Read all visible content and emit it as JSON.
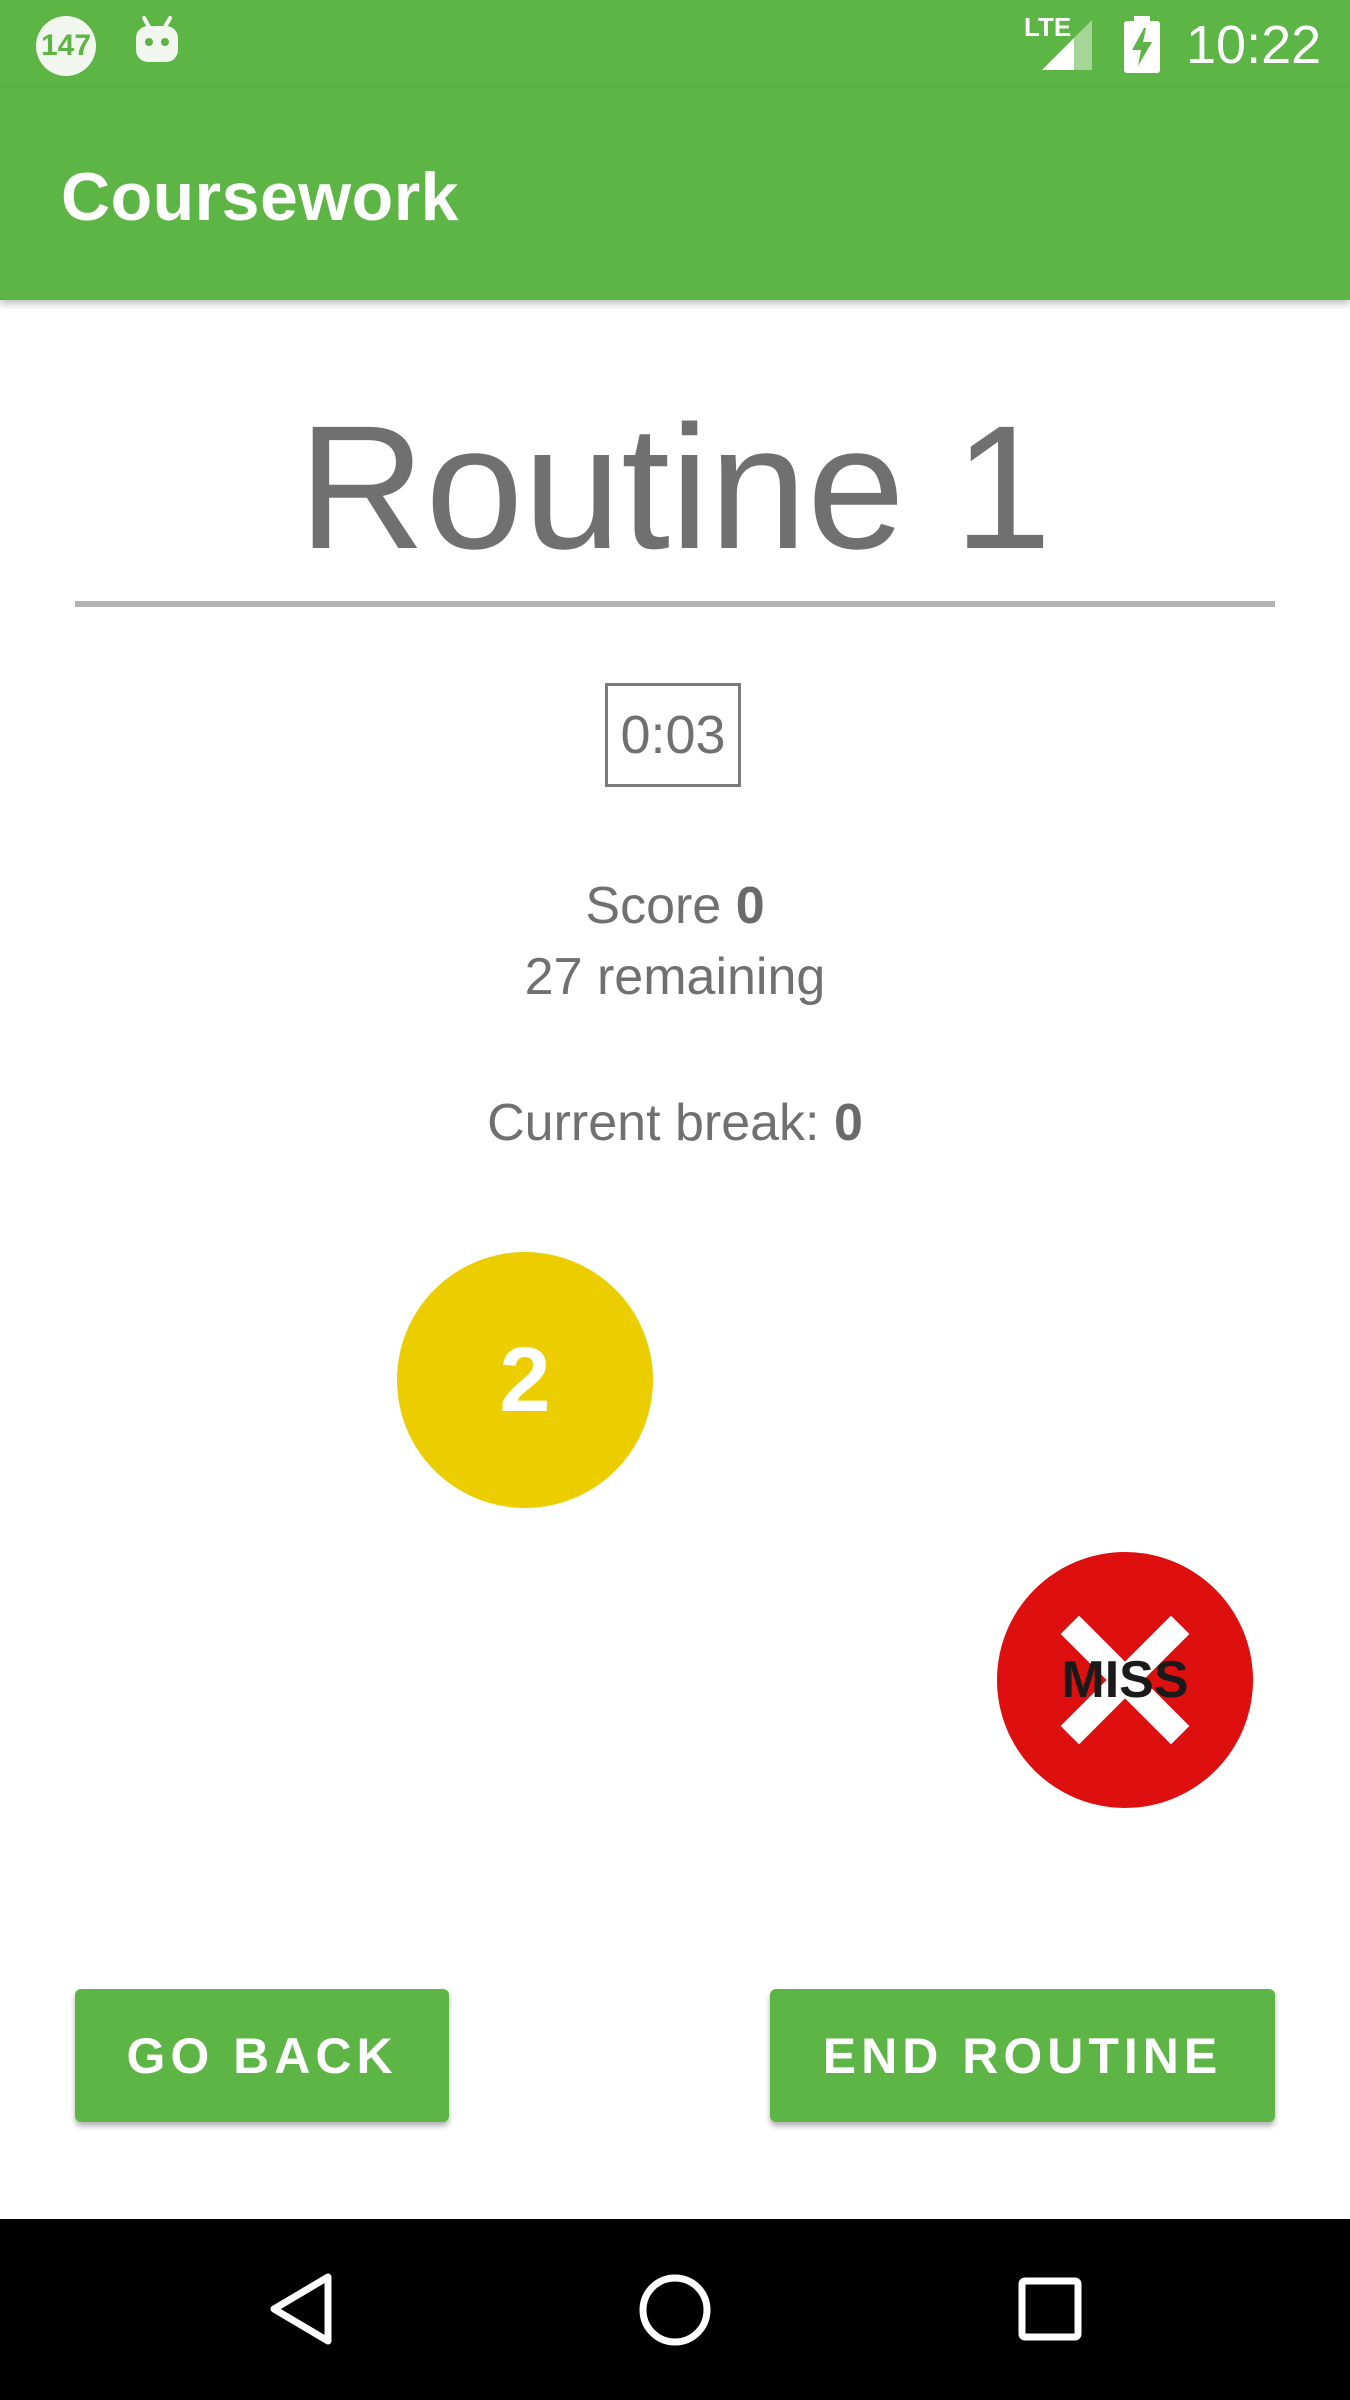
{
  "status_bar": {
    "notification_badge": "147",
    "network_label": "LTE",
    "time": "10:22",
    "icons": [
      "notification-count-icon",
      "android-icon",
      "signal-icon",
      "battery-charging-icon"
    ]
  },
  "app_bar": {
    "title": "Coursework"
  },
  "routine": {
    "title": "Routine 1",
    "timer": "0:03",
    "score_label": "Score",
    "score_value": "0",
    "remaining_value": "27",
    "remaining_label": "remaining",
    "break_label": "Current break:",
    "break_value": "0"
  },
  "targets": [
    {
      "label": "2",
      "color": "#ecce00"
    },
    {
      "label": "MISS",
      "color": "#dd0f0f",
      "icon": "cross-icon"
    }
  ],
  "buttons": {
    "back": "GO BACK",
    "end": "END ROUTINE"
  },
  "nav": {
    "icons": [
      "back-icon",
      "home-icon",
      "recents-icon"
    ]
  },
  "colors": {
    "primary": "#5cb544",
    "text_gray": "#707070",
    "target_yellow": "#ecce00",
    "miss_red": "#dd0f0f"
  }
}
